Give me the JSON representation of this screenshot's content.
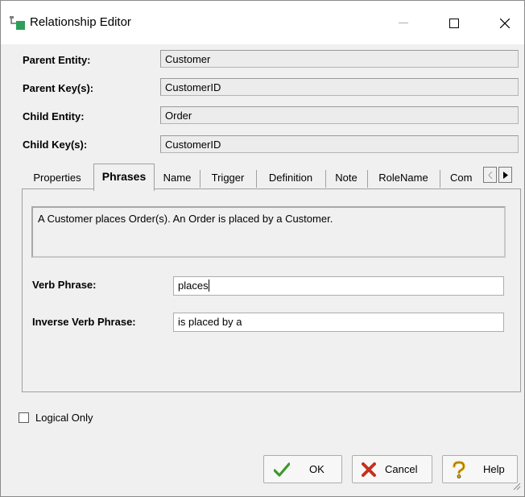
{
  "window": {
    "title": "Relationship Editor",
    "icon": "relationship-editor-app-icon",
    "controls": [
      "minimize-icon",
      "maximize-icon",
      "close-icon"
    ]
  },
  "fields": {
    "parent_entity_label": "Parent Entity:",
    "parent_entity_value": "Customer",
    "parent_keys_label": "Parent Key(s):",
    "parent_keys_value": "CustomerID",
    "child_entity_label": "Child Entity:",
    "child_entity_value": "Order",
    "child_keys_label": "Child Key(s):",
    "child_keys_value": "CustomerID"
  },
  "tabs": [
    {
      "label": "Properties",
      "active": false
    },
    {
      "label": "Phrases",
      "active": true
    },
    {
      "label": "Name",
      "active": false
    },
    {
      "label": "Trigger",
      "active": false
    },
    {
      "label": "Definition",
      "active": false
    },
    {
      "label": "Note",
      "active": false
    },
    {
      "label": "RoleName",
      "active": false
    },
    {
      "label": "Com",
      "active": false
    }
  ],
  "phrases": {
    "sentence": "A Customer places Order(s).  An Order is placed by a Customer.",
    "verb_label": "Verb Phrase:",
    "verb_value": "places",
    "inverse_label": "Inverse Verb Phrase:",
    "inverse_value": "is placed by a"
  },
  "logical_only": {
    "label": "Logical Only",
    "checked": false
  },
  "buttons": {
    "ok": "OK",
    "cancel": "Cancel",
    "help": "Help"
  },
  "colors": {
    "ok_check": "#3c9a2a",
    "cancel_x": "#c4311d",
    "help_question": "#e0a800",
    "icon_green": "#2f9e5a"
  }
}
